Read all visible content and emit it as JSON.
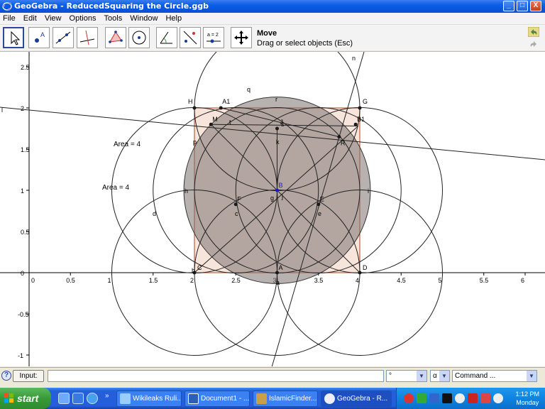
{
  "window": {
    "title": "GeoGebra - ReducedSquaring the Circle.ggb",
    "min_label": "_",
    "max_label": "□",
    "close_label": "X"
  },
  "menu": [
    "File",
    "Edit",
    "View",
    "Options",
    "Tools",
    "Window",
    "Help"
  ],
  "toolbar": {
    "active_tool": "Move",
    "hint": "Drag or select objects (Esc)",
    "slider_tool_label": "a = 2"
  },
  "axes": {
    "x_ticks": [
      "0",
      "0.5",
      "1",
      "1.5",
      "2",
      "2.5",
      "3",
      "3.5",
      "4",
      "4.5",
      "5",
      "5.5",
      "6"
    ],
    "y_ticks": [
      "2.5",
      "2",
      "1.5",
      "1",
      "0.5",
      "0",
      "-0.5",
      "-1"
    ]
  },
  "construction": {
    "area_labels": [
      "Area = 4",
      "Area = 4"
    ],
    "point_labels": {
      "H": "H",
      "A1": "A1",
      "G": "G",
      "M": "M",
      "B1": "B1",
      "R": "R",
      "F": "F",
      "E": "E",
      "B": "B",
      "C": "C",
      "A": "A",
      "D": "D",
      "J": "J"
    },
    "object_labels": {
      "n": "n",
      "l": "l",
      "q": "q",
      "r": "r",
      "t": "t",
      "s": "s",
      "k": "k",
      "p": "p",
      "h": "h",
      "i": "i",
      "d": "d",
      "c": "c",
      "e": "e",
      "g": "g",
      "j": "j",
      "b": "b",
      "a": "a"
    },
    "colors": {
      "square_fill": "#f4d8cc",
      "square_stroke": "#c0603c",
      "disk_fill": "#7b7170",
      "point": "#1a1a1a",
      "center_point": "#1a1acc"
    }
  },
  "input_bar": {
    "label": "Input:",
    "value": "",
    "symbol_select": "°",
    "greek_select": "α",
    "command_select": "Command ..."
  },
  "taskbar": {
    "start": "start",
    "tasks": [
      "Wikileaks Ruli...",
      "Document1 - ...",
      "IslamicFinder...",
      "GeoGebra - R..."
    ],
    "overflow": "»",
    "clock_time": "1:12 PM",
    "clock_day": "Monday"
  }
}
